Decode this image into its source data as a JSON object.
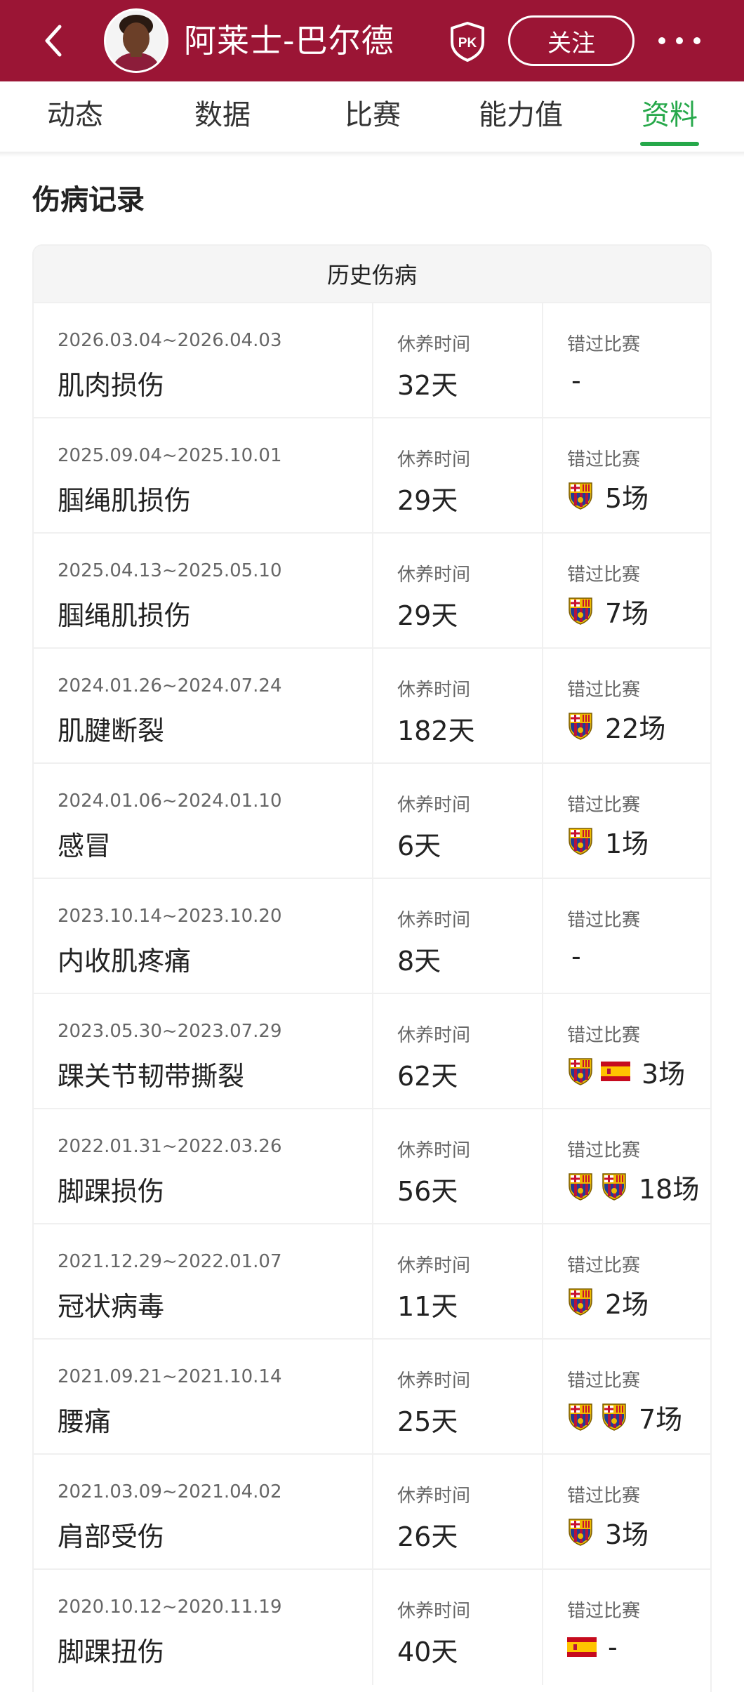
{
  "header": {
    "player_name": "阿莱士-巴尔德",
    "pk_label": "PK",
    "follow_label": "关注"
  },
  "tabs": [
    {
      "label": "动态"
    },
    {
      "label": "数据"
    },
    {
      "label": "比赛"
    },
    {
      "label": "能力值"
    },
    {
      "label": "资料"
    }
  ],
  "active_tab": "资料",
  "section_title": "伤病记录",
  "table_title": "历史伤病",
  "labels": {
    "rest": "休养时间",
    "missed": "错过比赛"
  },
  "injuries": [
    {
      "dates": "2026.03.04~2026.04.03",
      "injury": "肌肉损伤",
      "rest": "32天",
      "icons": [],
      "missed": "-"
    },
    {
      "dates": "2025.09.04~2025.10.01",
      "injury": "腘绳肌损伤",
      "rest": "29天",
      "icons": [
        "barcelona-crest"
      ],
      "missed": "5场"
    },
    {
      "dates": "2025.04.13~2025.05.10",
      "injury": "腘绳肌损伤",
      "rest": "29天",
      "icons": [
        "barcelona-crest"
      ],
      "missed": "7场"
    },
    {
      "dates": "2024.01.26~2024.07.24",
      "injury": "肌腱断裂",
      "rest": "182天",
      "icons": [
        "barcelona-crest"
      ],
      "missed": "22场"
    },
    {
      "dates": "2024.01.06~2024.01.10",
      "injury": "感冒",
      "rest": "6天",
      "icons": [
        "barcelona-crest"
      ],
      "missed": "1场"
    },
    {
      "dates": "2023.10.14~2023.10.20",
      "injury": "内收肌疼痛",
      "rest": "8天",
      "icons": [],
      "missed": "-"
    },
    {
      "dates": "2023.05.30~2023.07.29",
      "injury": "踝关节韧带撕裂",
      "rest": "62天",
      "icons": [
        "barcelona-crest",
        "spain-flag"
      ],
      "missed": "3场"
    },
    {
      "dates": "2022.01.31~2022.03.26",
      "injury": "脚踝损伤",
      "rest": "56天",
      "icons": [
        "barcelona-crest",
        "barcelona-crest"
      ],
      "missed": "18场"
    },
    {
      "dates": "2021.12.29~2022.01.07",
      "injury": "冠状病毒",
      "rest": "11天",
      "icons": [
        "barcelona-crest"
      ],
      "missed": "2场"
    },
    {
      "dates": "2021.09.21~2021.10.14",
      "injury": "腰痛",
      "rest": "25天",
      "icons": [
        "barcelona-crest",
        "barcelona-crest"
      ],
      "missed": "7场"
    },
    {
      "dates": "2021.03.09~2021.04.02",
      "injury": "肩部受伤",
      "rest": "26天",
      "icons": [
        "barcelona-crest"
      ],
      "missed": "3场"
    },
    {
      "dates": "2020.10.12~2020.11.19",
      "injury": "脚踝扭伤",
      "rest": "40天",
      "icons": [
        "spain-flag"
      ],
      "missed": "-"
    }
  ],
  "colors": {
    "header_bg": "#9b1535",
    "accent_green": "#26a84a",
    "barca_blue": "#1f3f94",
    "barca_red": "#b5123d",
    "barca_gold": "#edbb00"
  }
}
